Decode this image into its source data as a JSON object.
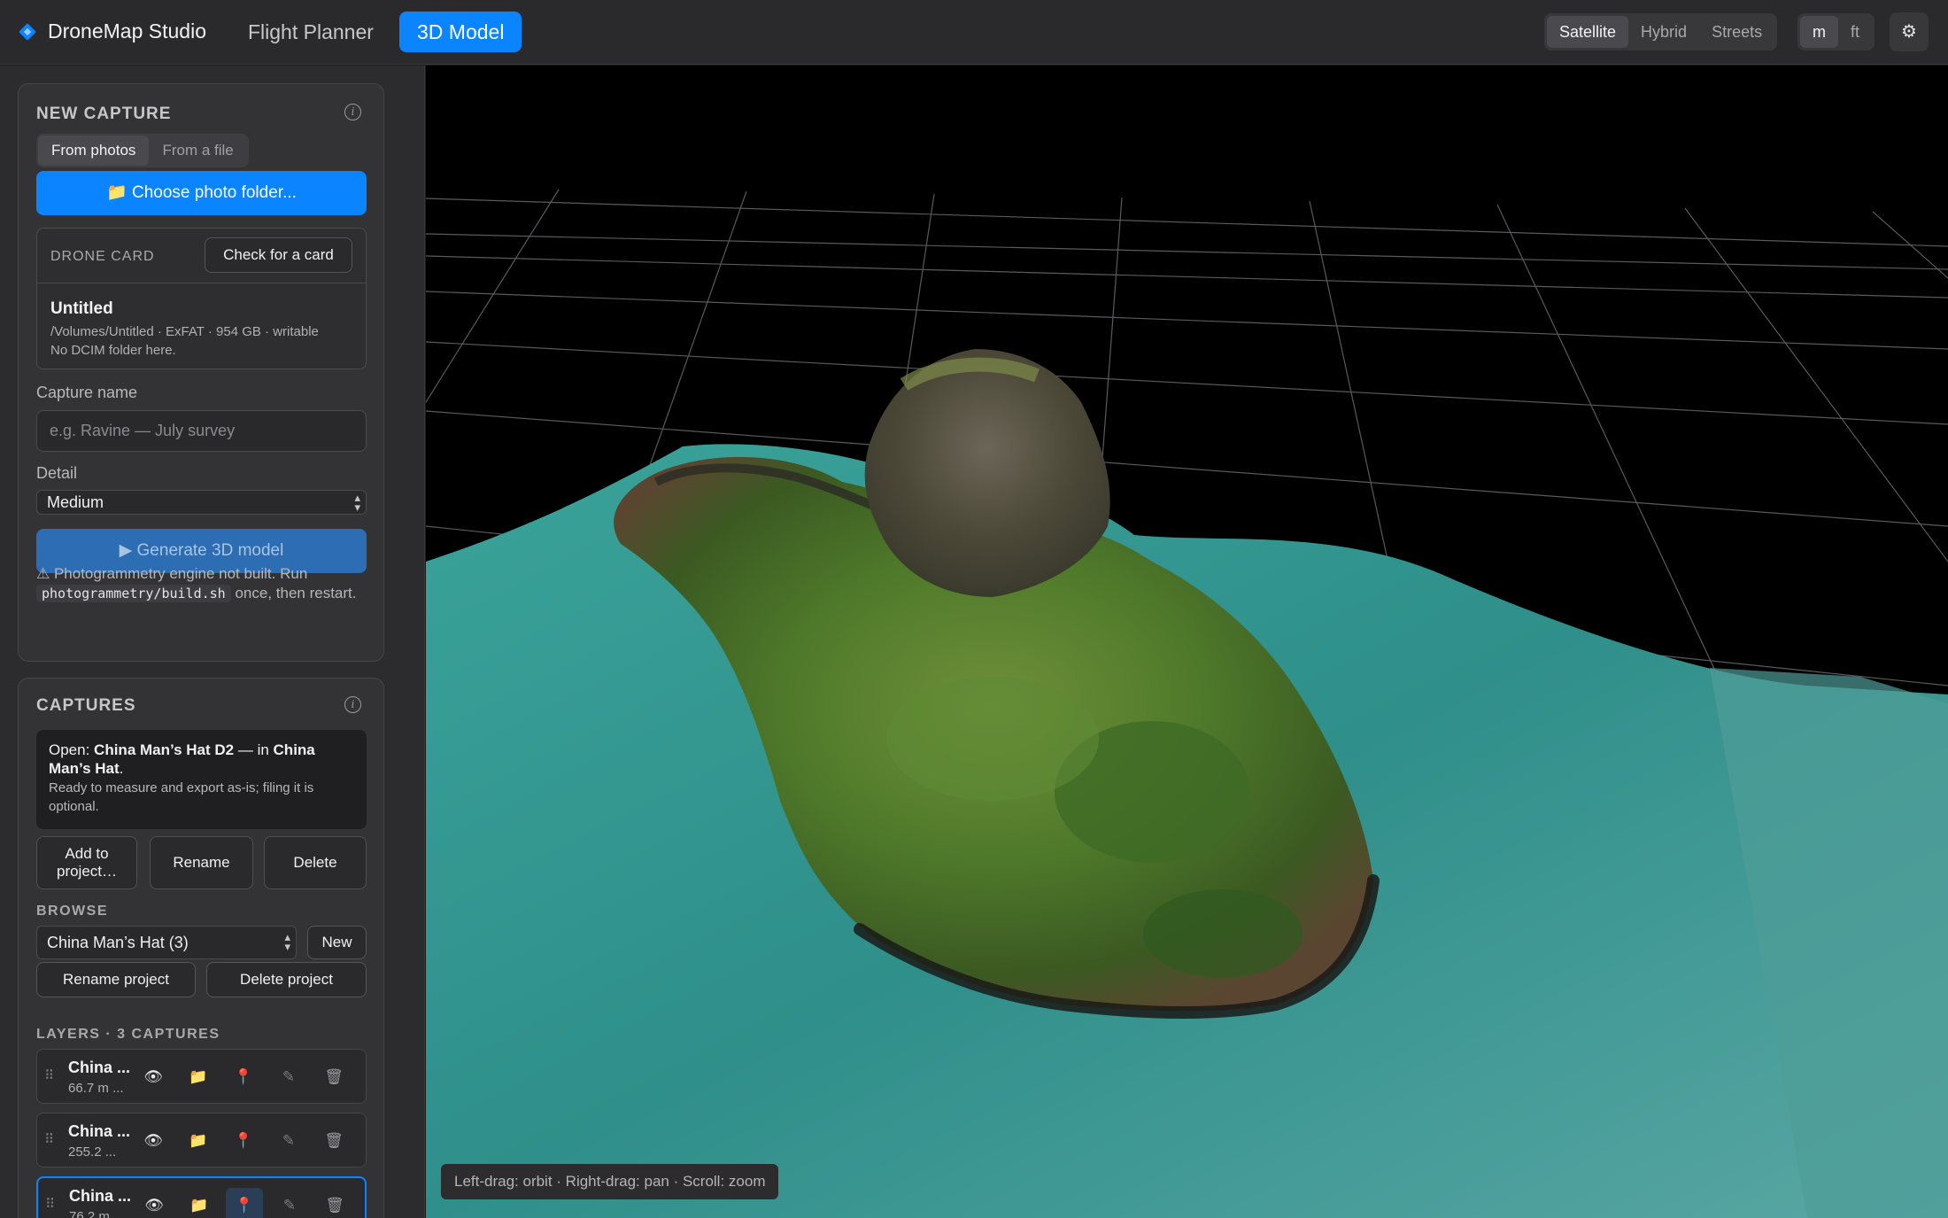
{
  "app": {
    "name": "DroneMap Studio"
  },
  "nav": {
    "tabs": [
      {
        "label": "Flight Planner"
      },
      {
        "label": "3D Model"
      }
    ],
    "active": "3D Model"
  },
  "map_style": {
    "options": [
      "Satellite",
      "Hybrid",
      "Streets"
    ],
    "active": "Satellite"
  },
  "units": {
    "options": [
      "m",
      "ft"
    ],
    "active": "m"
  },
  "settings_icon": "⚙",
  "new_capture": {
    "title": "NEW CAPTURE",
    "source_tabs": [
      "From photos",
      "From a file"
    ],
    "choose_button": "📁 Choose photo folder...",
    "drone_card": {
      "label": "DRONE CARD",
      "check_button": "Check for a card",
      "name": "Untitled",
      "details": "/Volumes/Untitled · ExFAT · 954 GB · writable",
      "note": "No DCIM folder here."
    },
    "capture_name_label": "Capture name",
    "capture_name_placeholder": "e.g. Ravine — July survey",
    "detail_label": "Detail",
    "detail_value": "Medium",
    "generate_button": "▶ Generate 3D model",
    "warning_pre": "⚠ Photogrammetry engine not built. Run",
    "warning_code": "photogrammetry/build.sh",
    "warning_post": "once, then restart."
  },
  "captures": {
    "title": "CAPTURES",
    "open_prefix": "Open: ",
    "open_capture": "China Man’s Hat D2",
    "open_mid": " — in ",
    "open_project": "China Man’s Hat",
    "open_suffix": ".",
    "open_note": "Ready to measure and export as-is; filing it is optional.",
    "add_to_project": "Add to project…",
    "rename": "Rename",
    "delete": "Delete",
    "browse_label": "BROWSE",
    "project_select": "China Man’s Hat (3)",
    "new_button": "New",
    "rename_project": "Rename project",
    "delete_project": "Delete project",
    "layers_label": "LAYERS · 3 CAPTURES",
    "layers": [
      {
        "name": "China ...",
        "size": "66.7 m ...",
        "selected": false
      },
      {
        "name": "China ...",
        "size": "255.2 ...",
        "selected": false
      },
      {
        "name": "China ...",
        "size": "76.2 m ...",
        "selected": true
      }
    ],
    "layer_icons": [
      "eye-icon",
      "folder-icon",
      "measure-icon",
      "edit-icon",
      "trash-icon"
    ]
  },
  "viewport": {
    "hint": "Left-drag: orbit · Right-drag: pan · Scroll: zoom"
  },
  "colors": {
    "accent": "#0a84ff",
    "background": "#1c1c1e",
    "panel": "#333336",
    "viewport": "#000000"
  }
}
